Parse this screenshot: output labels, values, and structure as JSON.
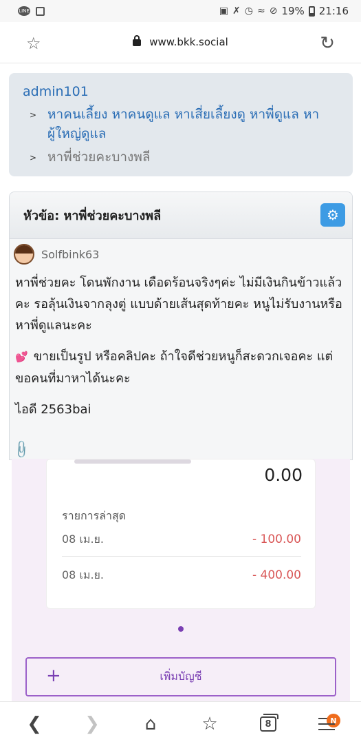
{
  "status_bar": {
    "battery": "19%",
    "time": "21:16"
  },
  "address_bar": {
    "url": "www.bkk.social"
  },
  "breadcrumb": {
    "root": "admin101",
    "items": [
      {
        "label": "หาคนเลี้ยง หาคนดูแล หาเสี่ยเลี้ยงดู หาพี่ดูแล หาผู้ใหญ่ดูแล"
      },
      {
        "label": "หาพี่ช่วยคะบางพลี"
      }
    ]
  },
  "post": {
    "title": "หัวข้อ: หาพี่ช่วยคะบางพลี",
    "author": "Solfbink63",
    "paragraph1": "หาพี่ช่วยคะ โดนพักงาน เดือดร้อนจริงๆค่ะ ไม่มีเงินกินข้าวแล้วคะ รอลุ้นเงินจากลุงตู่ แบบด้ายเส้นสุดท้ายคะ หนูไม่รับงานหรือหาพี่ดูแลนะคะ",
    "paragraph2_emoji": "💕",
    "paragraph2": "ขายเป็นรูป หรือคลิปคะ ถ้าใจดีช่วยหนูก็สะดวกเจอคะ แต่ขอคนที่มาหาได้นะคะ",
    "paragraph3": "ไอดี 2563bai"
  },
  "embedded_app": {
    "balance": "0.00",
    "recent_label": "รายการล่าสุด",
    "transactions": [
      {
        "date": "08 เม.ย.",
        "amount": "- 100.00"
      },
      {
        "date": "08 เม.ย.",
        "amount": "- 400.00"
      }
    ],
    "add_account_label": "เพิ่มบัญชี"
  },
  "nav_bar": {
    "tabs_count": "8",
    "menu_badge": "N"
  },
  "colors": {
    "link": "#2a6db5",
    "gear_button": "#3d9be4",
    "negative_amount": "#d95757",
    "accent_purple": "#7a3fb3",
    "badge_orange": "#ef6c1c"
  }
}
